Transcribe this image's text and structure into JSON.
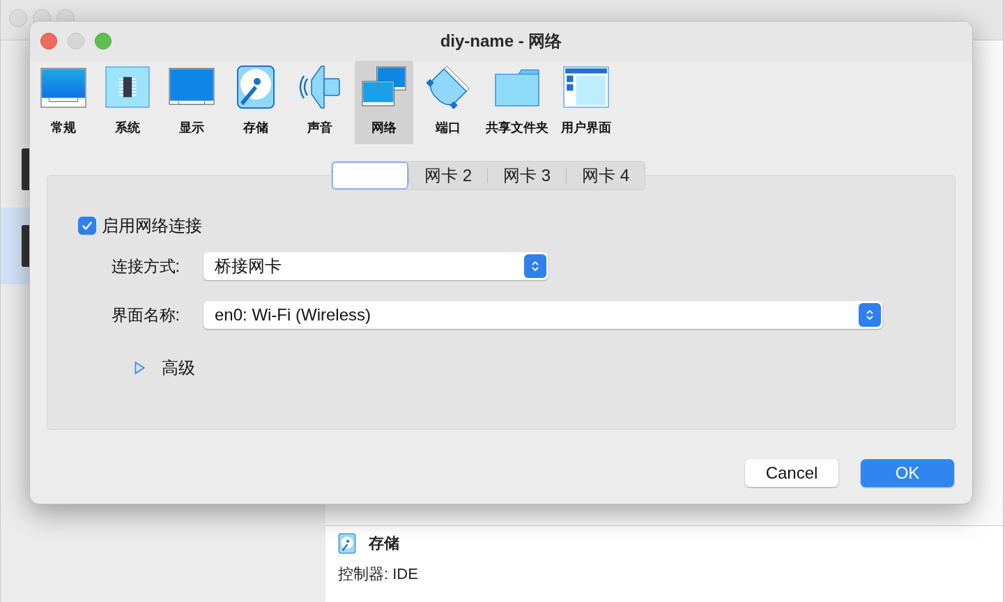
{
  "background_window": {
    "details": [
      {
        "kind": "section",
        "label": "存储"
      },
      {
        "kind": "line",
        "label": "控制器: IDE"
      }
    ]
  },
  "window": {
    "title": "diy-name - 网络"
  },
  "categories": [
    {
      "kind": "general",
      "label": "常规",
      "selected": false
    },
    {
      "kind": "system",
      "label": "系统",
      "selected": false
    },
    {
      "kind": "display",
      "label": "显示",
      "selected": false
    },
    {
      "kind": "storage",
      "label": "存储",
      "selected": false
    },
    {
      "kind": "audio",
      "label": "声音",
      "selected": false
    },
    {
      "kind": "network",
      "label": "网络",
      "selected": true
    },
    {
      "kind": "ports",
      "label": "端口",
      "selected": false
    },
    {
      "kind": "shared",
      "label": "共享文件夹",
      "selected": false
    },
    {
      "kind": "ui",
      "label": "用户界面",
      "selected": false
    }
  ],
  "tabs": [
    {
      "selected": true
    },
    {
      "label": "网卡 2",
      "selected": false
    },
    {
      "label": "网卡 3",
      "selected": false
    },
    {
      "label": "网卡 4",
      "selected": false
    }
  ],
  "enable_adapter": {
    "label": "启用网络连接",
    "checked": true
  },
  "fields": [
    {
      "label": "连接方式:",
      "value": "桥接网卡",
      "wide": false
    },
    {
      "label": "界面名称:",
      "value": "en0: Wi-Fi (Wireless)",
      "wide": true
    }
  ],
  "advanced": {
    "label": "高级",
    "expanded": false
  },
  "buttons": [
    {
      "label": "Cancel",
      "primary": false
    },
    {
      "label": "OK",
      "primary": true
    }
  ]
}
